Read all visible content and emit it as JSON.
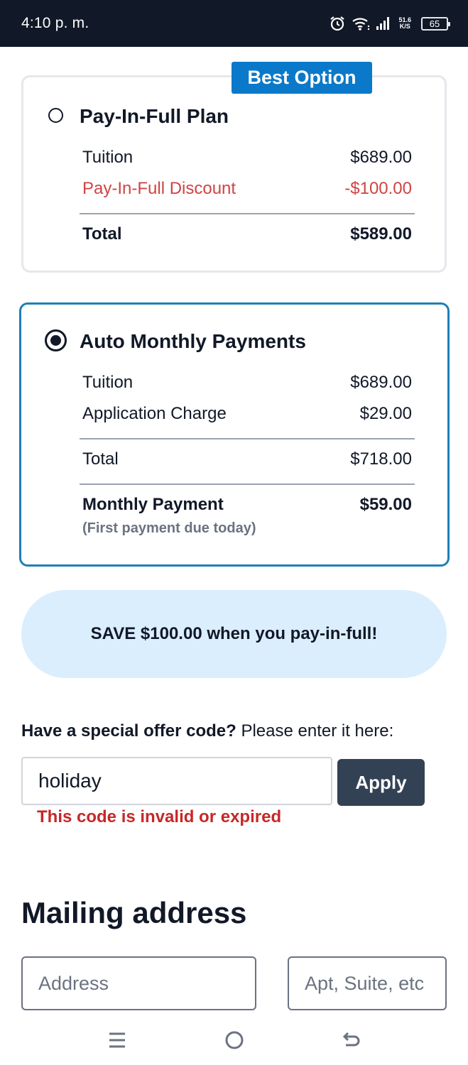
{
  "status_bar": {
    "time": "4:10 p. m.",
    "net_speed_value": "51.6",
    "net_speed_unit": "K/S",
    "battery": "65",
    "icons": [
      "alarm-icon",
      "wifi-icon",
      "signal-icon",
      "battery-icon"
    ]
  },
  "plans": {
    "best_badge": "Best Option",
    "full": {
      "title": "Pay-In-Full Plan",
      "selected": false,
      "rows": [
        {
          "label": "Tuition",
          "amount": "$689.00"
        },
        {
          "label": "Pay-In-Full Discount",
          "amount": "-$100.00"
        }
      ],
      "total_label": "Total",
      "total_amount": "$589.00"
    },
    "monthly": {
      "title": "Auto Monthly Payments",
      "selected": true,
      "rows": [
        {
          "label": "Tuition",
          "amount": "$689.00"
        },
        {
          "label": "Application Charge",
          "amount": "$29.00"
        }
      ],
      "total_label": "Total",
      "total_amount": "$718.00",
      "monthly_label": "Monthly Payment",
      "monthly_amount": "$59.00",
      "monthly_note": "(First payment due today)"
    }
  },
  "save_banner": "SAVE $100.00 when you pay-in-full!",
  "offer": {
    "prompt_bold": "Have a special offer code?",
    "prompt_rest": " Please enter it here:",
    "code_value": "holiday",
    "apply_label": "Apply",
    "error": "This code is invalid or expired"
  },
  "mailing": {
    "title": "Mailing address",
    "address_placeholder": "Address",
    "apt_placeholder": "Apt, Suite, etc"
  },
  "colors": {
    "accent": "#0b79c9",
    "selected_border": "#1e7fb8",
    "discount_red": "#d14343",
    "error_red": "#c62828",
    "banner_bg": "#dbeefe",
    "apply_bg": "#334155"
  },
  "nav": {
    "icons": [
      "menu-icon",
      "home-circle-icon",
      "back-icon"
    ]
  }
}
